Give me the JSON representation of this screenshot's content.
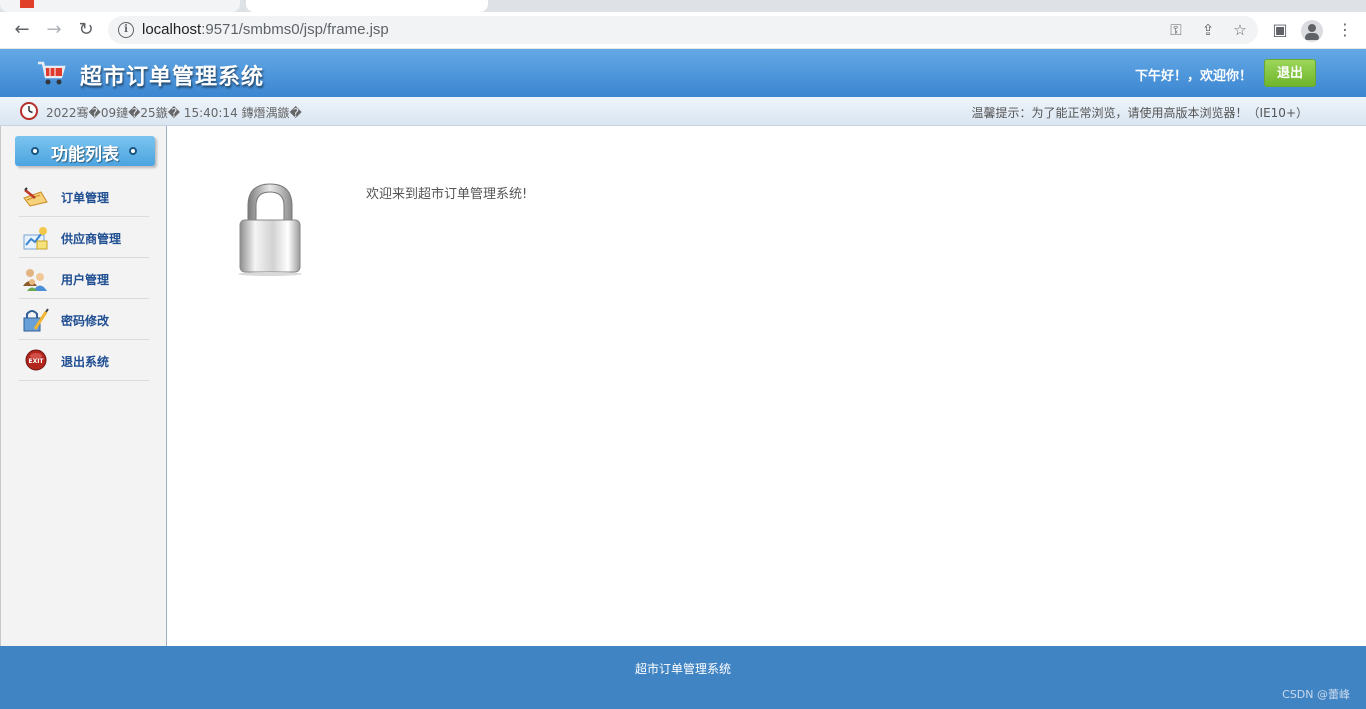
{
  "browser": {
    "tabs": [
      {
        "title": ""
      },
      {
        "title": ""
      }
    ],
    "url_host": "localhost",
    "url_rest": ":9571/smbms0/jsp/frame.jsp"
  },
  "header": {
    "title": "超市订单管理系统",
    "greeting": "下午好！，欢迎你！",
    "logout_label": "退出"
  },
  "info_bar": {
    "time": "2022骞�09鏈�25鏃� 15:40:14 鏄熸湡鏃�",
    "tip": "温馨提示：为了能正常浏览，请使用高版本浏览器！（IE10+）"
  },
  "sidebar": {
    "title": "功能列表",
    "items": [
      {
        "label": "订单管理",
        "icon": "order-icon"
      },
      {
        "label": "供应商管理",
        "icon": "supplier-icon"
      },
      {
        "label": "用户管理",
        "icon": "users-icon"
      },
      {
        "label": "密码修改",
        "icon": "password-icon"
      },
      {
        "label": "退出系统",
        "icon": "exit-icon"
      }
    ]
  },
  "main": {
    "welcome": "欢迎来到超市订单管理系统!"
  },
  "footer": {
    "text": "超市订单管理系统",
    "watermark": "CSDN @蕾峰"
  },
  "colors": {
    "header_blue": "#3b86d1",
    "footer_blue": "#4184c3",
    "logout_green": "#7dbf3a",
    "menu_text": "#1f4e92"
  }
}
